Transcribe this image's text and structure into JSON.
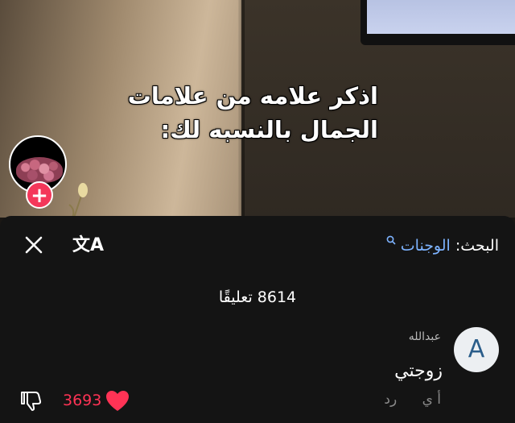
{
  "video": {
    "caption_line1": "اذكر علامه من علامات",
    "caption_line2": "الجمال بالنسبه لك:",
    "follow_icon": "plus-icon"
  },
  "comments_panel": {
    "close_icon": "close-icon",
    "translate_label": "文A",
    "search_prefix": "البحث:",
    "search_term": "الوجنات",
    "comment_count_text": "8614 تعليقًا",
    "comment": {
      "avatar_letter": "A",
      "username": "عبدالله",
      "text": "زوجتي",
      "time": "أ ي",
      "reply_label": "رد",
      "like_count": "3693"
    }
  },
  "colors": {
    "accent_red": "#ff3355",
    "link_blue": "#7db3ff",
    "follow_pink": "#f4375a",
    "sheet_bg": "#141414"
  }
}
